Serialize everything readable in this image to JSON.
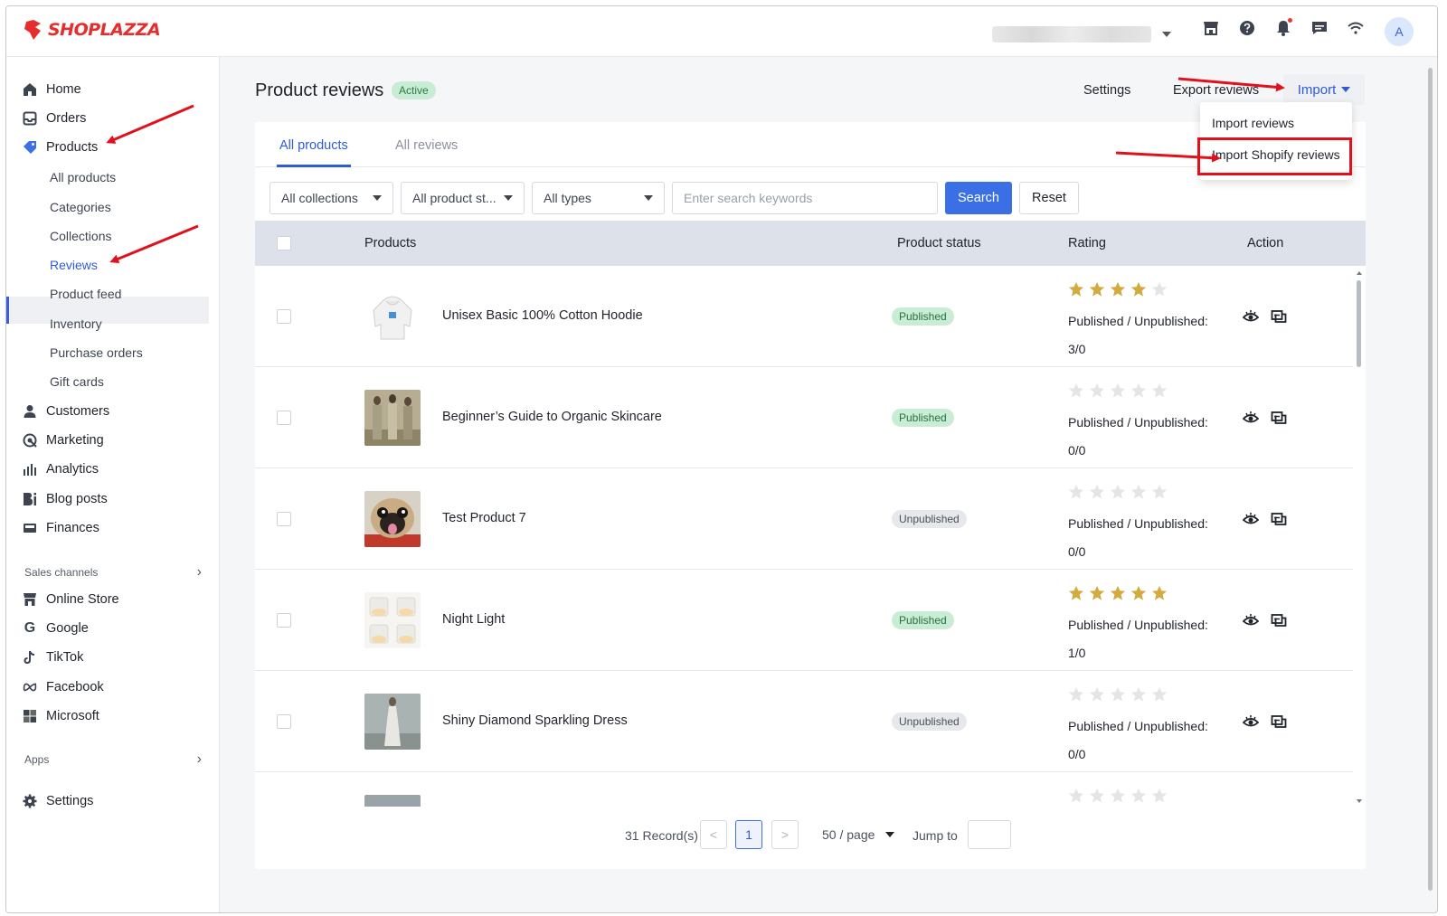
{
  "brand": {
    "name": "SHOPLAZZA",
    "color": "#e52d2d",
    "avatar_letter": "A"
  },
  "topbar": {
    "icons": [
      "store-icon",
      "help-icon",
      "bell-icon",
      "chat-icon",
      "wifi-icon"
    ]
  },
  "sidebar": {
    "items": [
      {
        "label": "Home",
        "icon": "home-icon"
      },
      {
        "label": "Orders",
        "icon": "inbox-icon"
      },
      {
        "label": "Products",
        "icon": "tag-icon"
      }
    ],
    "product_sub": [
      "All products",
      "Categories",
      "Collections",
      "Reviews",
      "Product feed",
      "Inventory",
      "Purchase orders",
      "Gift cards"
    ],
    "items2": [
      {
        "label": "Customers",
        "icon": "person-icon"
      },
      {
        "label": "Marketing",
        "icon": "marketing-icon"
      },
      {
        "label": "Analytics",
        "icon": "analytics-icon"
      },
      {
        "label": "Blog posts",
        "icon": "blog-icon"
      },
      {
        "label": "Finances",
        "icon": "finance-icon"
      }
    ],
    "sales_channels_label": "Sales channels",
    "channels": [
      {
        "label": "Online Store",
        "icon": "store-icon"
      },
      {
        "label": "Google",
        "icon": "google-icon"
      },
      {
        "label": "TikTok",
        "icon": "tiktok-icon"
      },
      {
        "label": "Facebook",
        "icon": "meta-icon"
      },
      {
        "label": "Microsoft",
        "icon": "microsoft-icon"
      }
    ],
    "apps_label": "Apps",
    "settings_label": "Settings"
  },
  "header": {
    "title": "Product reviews",
    "badge": "Active",
    "settings": "Settings",
    "export": "Export reviews",
    "import": "Import"
  },
  "import_menu": [
    "Import reviews",
    "Import Shopify reviews"
  ],
  "tabs": [
    "All products",
    "All reviews"
  ],
  "filters": {
    "collections": "All collections",
    "status": "All product st...",
    "types": "All types",
    "search_placeholder": "Enter search keywords",
    "search_btn": "Search",
    "reset_btn": "Reset"
  },
  "table": {
    "columns": [
      "Products",
      "Product status",
      "Rating",
      "Action"
    ],
    "rating_label": "Published / Unpublished:",
    "rows": [
      {
        "name": "Unisex Basic 100% Cotton Hoodie",
        "status": "Published",
        "stars": 4,
        "count": "3/0"
      },
      {
        "name": "Beginner’s Guide to Organic Skincare",
        "status": "Published",
        "stars": 0,
        "count": "0/0"
      },
      {
        "name": "Test Product 7",
        "status": "Unpublished",
        "stars": 0,
        "count": "0/0"
      },
      {
        "name": "Night Light",
        "status": "Published",
        "stars": 5,
        "count": "1/0"
      },
      {
        "name": "Shiny Diamond Sparkling Dress",
        "status": "Unpublished",
        "stars": 0,
        "count": "0/0"
      }
    ]
  },
  "pagination": {
    "records": "31 Record(s)",
    "prev": "<",
    "page": "1",
    "next": ">",
    "page_size": "50 / page",
    "jump_label": "Jump to"
  },
  "colors": {
    "primary": "#3a6fe6",
    "star_filled": "#d4a93e",
    "star_empty": "#e3e5e8",
    "annotation_red": "#e0111b"
  }
}
